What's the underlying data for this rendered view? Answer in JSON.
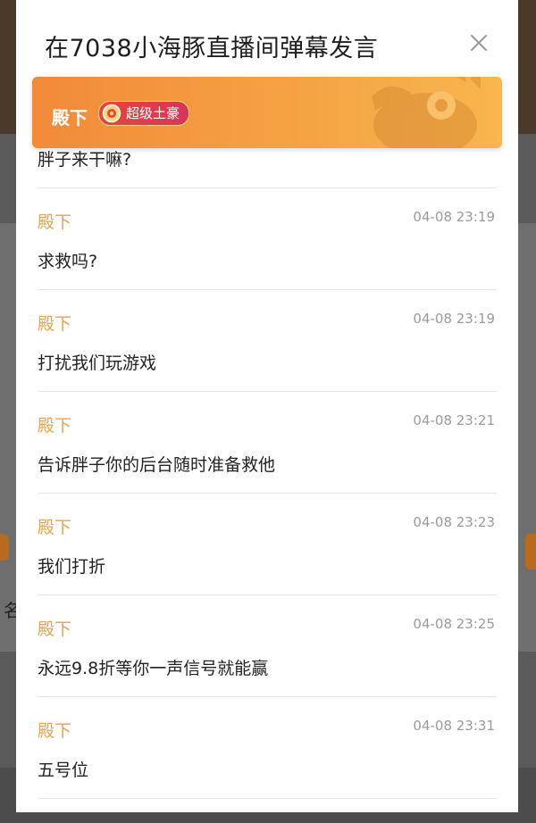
{
  "background": {
    "partial_char": "名"
  },
  "modal": {
    "title": "在7038小海豚直播间弹幕发言",
    "sender": {
      "name": "殿下",
      "badge": "超级土豪"
    },
    "partial_message": "胖子来干嘛?",
    "messages": [
      {
        "user": "殿下",
        "time": "04-08 23:19",
        "text": "求救吗?"
      },
      {
        "user": "殿下",
        "time": "04-08 23:19",
        "text": "打扰我们玩游戏"
      },
      {
        "user": "殿下",
        "time": "04-08 23:21",
        "text": "告诉胖子你的后台随时准备救他"
      },
      {
        "user": "殿下",
        "time": "04-08 23:23",
        "text": "我们打折"
      },
      {
        "user": "殿下",
        "time": "04-08 23:25",
        "text": "永远9.8折等你一声信号就能赢"
      },
      {
        "user": "殿下",
        "time": "04-08 23:31",
        "text": "五号位"
      }
    ]
  },
  "icons": {
    "close": "close-icon",
    "badge": "medal-icon",
    "banner_decoration": "horse-mascot-icon"
  },
  "colors": {
    "banner_start": "#f28a39",
    "banner_end": "#f7b64e",
    "username": "#e8a24a",
    "time": "#9a9a9a",
    "badge": "#e0493a"
  }
}
